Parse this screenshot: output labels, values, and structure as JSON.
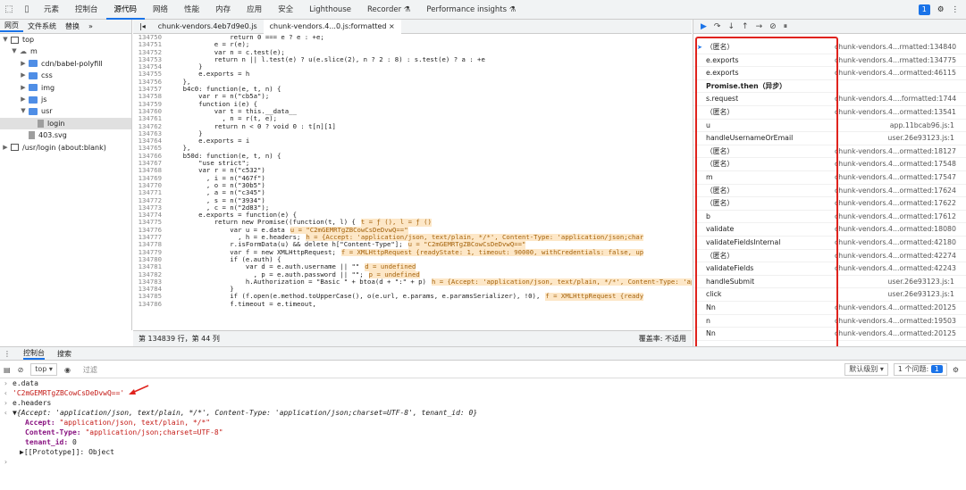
{
  "top_tabs": [
    "元素",
    "控制台",
    "源代码",
    "网络",
    "性能",
    "内存",
    "应用",
    "安全",
    "Lighthouse",
    "Recorder ⚗",
    "Performance insights ⚗"
  ],
  "top_active": "源代码",
  "issues_badge": "1",
  "nav": {
    "tabs": [
      "网页",
      "文件系统",
      "替换",
      "»"
    ],
    "tree": [
      {
        "label": "top",
        "kind": "frame",
        "indent": 0,
        "arrow": "▼"
      },
      {
        "label": "m",
        "kind": "cloud",
        "indent": 1,
        "arrow": "▼"
      },
      {
        "label": "cdn/babel-polyfill",
        "kind": "folder",
        "indent": 2,
        "arrow": "▶"
      },
      {
        "label": "css",
        "kind": "folder",
        "indent": 2,
        "arrow": "▶"
      },
      {
        "label": "img",
        "kind": "folder",
        "indent": 2,
        "arrow": "▶"
      },
      {
        "label": "js",
        "kind": "folder",
        "indent": 2,
        "arrow": "▶"
      },
      {
        "label": "usr",
        "kind": "folder",
        "indent": 2,
        "arrow": "▼"
      },
      {
        "label": "login",
        "kind": "file",
        "indent": 3,
        "arrow": "",
        "selected": true
      },
      {
        "label": "403.svg",
        "kind": "file",
        "indent": 2,
        "arrow": ""
      },
      {
        "label": "/usr/login (about:blank)",
        "kind": "frame",
        "indent": 0,
        "arrow": "▶"
      }
    ]
  },
  "editor": {
    "tabs": [
      "chunk-vendors.4eb7d9e0.js",
      "chunk-vendors.4...0.js:formatted ×"
    ],
    "lines": [
      {
        "n": "134750",
        "t": "                return 0 === e ? e : +e;",
        "h": ""
      },
      {
        "n": "134751",
        "t": "            e = r(e);",
        "h": ""
      },
      {
        "n": "134752",
        "t": "            var n = c.test(e);",
        "h": ""
      },
      {
        "n": "134753",
        "t": "            return n || l.test(e) ? u(e.slice(2), n ? 2 : 8) : s.test(e) ? a : +e",
        "h": ""
      },
      {
        "n": "134754",
        "t": "        }",
        "h": ""
      },
      {
        "n": "134755",
        "t": "        e.exports = h",
        "h": ""
      },
      {
        "n": "134756",
        "t": "    },",
        "h": ""
      },
      {
        "n": "134757",
        "t": "    b4c0: function(e, t, n) {",
        "h": ""
      },
      {
        "n": "134758",
        "t": "        var r = n(\"cb5a\");",
        "h": ""
      },
      {
        "n": "134759",
        "t": "        function i(e) {",
        "h": ""
      },
      {
        "n": "134760",
        "t": "            var t = this.__data__",
        "h": ""
      },
      {
        "n": "134761",
        "t": "              , n = r(t, e);",
        "h": ""
      },
      {
        "n": "134762",
        "t": "            return n < 0 ? void 0 : t[n][1]",
        "h": ""
      },
      {
        "n": "134763",
        "t": "        }",
        "h": ""
      },
      {
        "n": "134764",
        "t": "        e.exports = i",
        "h": ""
      },
      {
        "n": "134765",
        "t": "    },",
        "h": ""
      },
      {
        "n": "134766",
        "t": "    b50d: function(e, t, n) {",
        "h": ""
      },
      {
        "n": "134767",
        "t": "        \"use strict\";",
        "h": ""
      },
      {
        "n": "134768",
        "t": "        var r = n(\"c532\")",
        "h": ""
      },
      {
        "n": "134769",
        "t": "          , i = n(\"467f\")",
        "h": ""
      },
      {
        "n": "134770",
        "t": "          , o = n(\"30b5\")",
        "h": ""
      },
      {
        "n": "134771",
        "t": "          , a = n(\"c345\")",
        "h": ""
      },
      {
        "n": "134772",
        "t": "          , s = n(\"3934\")",
        "h": ""
      },
      {
        "n": "134773",
        "t": "          , c = n(\"2d83\");",
        "h": ""
      },
      {
        "n": "134774",
        "t": "        e.exports = function(e) {",
        "h": ""
      },
      {
        "n": "134775",
        "t": "            return new Promise((function(t, l) {",
        "h": "t = ƒ (), l = ƒ ()"
      },
      {
        "n": "134776",
        "t": "                var u = e.data",
        "h": "u = \"C2mGEMRTgZBCowCsDeDvwQ==\""
      },
      {
        "n": "134777",
        "t": "                  , h = e.headers;",
        "h": "h = {Accept: 'application/json, text/plain, */*', Content-Type: 'application/json;char"
      },
      {
        "n": "134778",
        "t": "                r.isFormData(u) && delete h[\"Content-Type\"];",
        "h": "u = \"C2mGEMRTgZBCowCsDeDvwQ==\""
      },
      {
        "n": "134779",
        "t": "                var f = new XMLHttpRequest;",
        "h": "f = XMLHttpRequest {readyState: 1, timeout: 90000, withCredentials: false, up"
      },
      {
        "n": "134780",
        "t": "                if (e.auth) {",
        "h": ""
      },
      {
        "n": "134781",
        "t": "                    var d = e.auth.username || \"\"",
        "h": "d = undefined"
      },
      {
        "n": "134782",
        "t": "                      , p = e.auth.password || \"\";",
        "h": "p = undefined"
      },
      {
        "n": "134783",
        "t": "                    h.Authorization = \"Basic \" + btoa(d + \":\" + p)",
        "h": "h = {Accept: 'application/json, text/plain, */*', Content-Type: 'applicati"
      },
      {
        "n": "134784",
        "t": "                }",
        "h": ""
      },
      {
        "n": "134785",
        "t": "                if (f.open(e.method.toUpperCase(), o(e.url, e.params, e.paramsSerializer), !0),",
        "h": "f = XMLHttpRequest {ready"
      },
      {
        "n": "134786",
        "t": "                f.timeout = e.timeout,",
        "h": ""
      }
    ]
  },
  "status": {
    "position": "第 134839 行，第 44 列",
    "coverage": "覆盖率: 不适用"
  },
  "callstack": [
    {
      "fn": "（匿名）",
      "loc": "chunk-vendors.4...rmatted:134840",
      "current": true
    },
    {
      "fn": "e.exports",
      "loc": "chunk-vendors.4...rmatted:134775"
    },
    {
      "fn": "e.exports",
      "loc": "chunk-vendors.4...ormatted:46115"
    },
    {
      "fn": "Promise.then（异步）",
      "loc": "",
      "async": true
    },
    {
      "fn": "s.request",
      "loc": "chunk-vendors.4....formatted:1744"
    },
    {
      "fn": "（匿名）",
      "loc": "chunk-vendors.4...ormatted:13541"
    },
    {
      "fn": "u",
      "loc": "app.11bcab96.js:1"
    },
    {
      "fn": "handleUsernameOrEmail",
      "loc": "user.26e93123.js:1"
    },
    {
      "fn": "（匿名）",
      "loc": "chunk-vendors.4...ormatted:18127"
    },
    {
      "fn": "（匿名）",
      "loc": "chunk-vendors.4...ormatted:17548"
    },
    {
      "fn": "m",
      "loc": "chunk-vendors.4...ormatted:17547"
    },
    {
      "fn": "（匿名）",
      "loc": "chunk-vendors.4...ormatted:17624"
    },
    {
      "fn": "（匿名）",
      "loc": "chunk-vendors.4...ormatted:17622"
    },
    {
      "fn": "b",
      "loc": "chunk-vendors.4...ormatted:17612"
    },
    {
      "fn": "validate",
      "loc": "chunk-vendors.4...ormatted:18080"
    },
    {
      "fn": "validateFieldsInternal",
      "loc": "chunk-vendors.4...ormatted:42180"
    },
    {
      "fn": "（匿名）",
      "loc": "chunk-vendors.4...ormatted:42274"
    },
    {
      "fn": "validateFields",
      "loc": "chunk-vendors.4...ormatted:42243"
    },
    {
      "fn": "handleSubmit",
      "loc": "user.26e93123.js:1"
    },
    {
      "fn": "click",
      "loc": "user.26e93123.js:1"
    },
    {
      "fn": "Nn",
      "loc": "chunk-vendors.4...ormatted:20125"
    },
    {
      "fn": "n",
      "loc": "chunk-vendors.4...ormatted:19503"
    },
    {
      "fn": "Nn",
      "loc": "chunk-vendors.4...ormatted:20125"
    }
  ],
  "console": {
    "tabs": [
      "控制台",
      "搜索"
    ],
    "context": "top ▾",
    "filter_placeholder": "过滤",
    "level": "默认级别 ▾",
    "issues": "1 个问题: ",
    "issues_count": "1",
    "lines": [
      {
        "type": "input",
        "text": "e.data"
      },
      {
        "type": "str",
        "text": "'C2mGEMRTgZBCowCsDeDvwQ=='"
      },
      {
        "type": "input",
        "text": "e.headers"
      },
      {
        "type": "obj",
        "text": "▼{Accept: 'application/json, text/plain, */*', Content-Type: 'application/json;charset=UTF-8', tenant_id: 0}"
      },
      {
        "type": "kv",
        "key": "Accept:",
        "val": " \"application/json, text/plain, */*\""
      },
      {
        "type": "kv",
        "key": "Content-Type:",
        "val": " \"application/json;charset=UTF-8\""
      },
      {
        "type": "kv",
        "key": "tenant_id:",
        "val": " 0"
      },
      {
        "type": "proto",
        "text": "▶[[Prototype]]: Object"
      }
    ]
  }
}
